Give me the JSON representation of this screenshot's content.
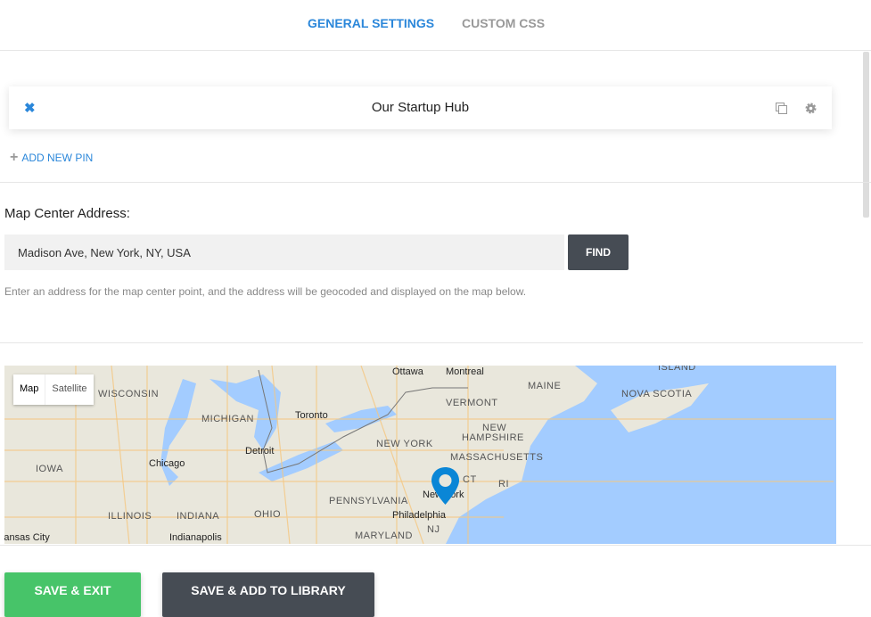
{
  "tabs": [
    {
      "label": "GENERAL SETTINGS",
      "active": true
    },
    {
      "label": "CUSTOM CSS",
      "active": false
    }
  ],
  "pin": {
    "title": "Our Startup Hub",
    "icons": [
      "close-icon",
      "copy-icon",
      "gear-icon"
    ]
  },
  "add_pin_label": "ADD NEW PIN",
  "map_center": {
    "label": "Map Center Address:",
    "value": "Madison Ave, New York, NY, USA",
    "find_label": "FIND",
    "help": "Enter an address for the map center point, and the address will be geocoded and displayed on the map below."
  },
  "map": {
    "type_map": "Map",
    "type_satellite": "Satellite",
    "marker_color": "#0a86d6",
    "labels": [
      "Ottawa",
      "Montreal",
      "ISLAND",
      "WISCONSIN",
      "MAINE",
      "NOVA SCOTIA",
      "VERMONT",
      "MICHIGAN",
      "Toronto",
      "NEW",
      "HAMPSHIRE",
      "NEW YORK",
      "Detroit",
      "MASSACHUSETTS",
      "IOWA",
      "Chicago",
      "CT",
      "RI",
      "New York",
      "PENNSYLVANIA",
      "ILLINOIS",
      "INDIANA",
      "OHIO",
      "Philadelphia",
      "NJ",
      "Kansas City",
      "Indianapolis",
      "MARYLAND"
    ]
  },
  "buttons": {
    "save_exit": "SAVE & EXIT",
    "save_library": "SAVE & ADD TO LIBRARY"
  },
  "colors": {
    "accent": "#2b87da",
    "save": "#47c469",
    "dark": "#464c54",
    "water": "#a3ccff"
  }
}
